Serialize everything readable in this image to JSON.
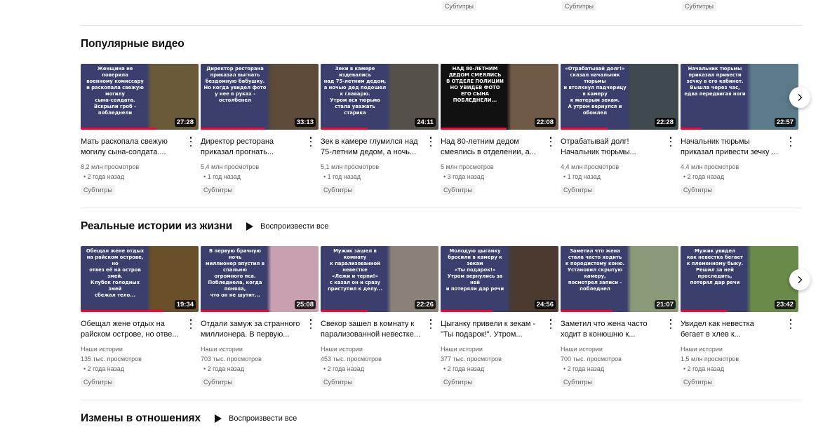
{
  "top_badges": [
    "Субтитры",
    "Субтитры",
    "Субтитры"
  ],
  "sections": [
    {
      "title": "Популярные видео",
      "play_all": "",
      "videos": [
        {
          "title": "Мать раскопала свежую\nмогилу сына-солдата....",
          "views": "8,2 млн просмотров",
          "age": "• 2 года назад",
          "badge": "Субтитры",
          "duration": "27:28",
          "thumb_text": "Женщина не поверила\nвоенному комиссару\nи раскопала свежую могилу\nсына-солдата.\nВскрыли гроб - побледнели",
          "colors": [
            "#3a3f6e",
            "#6b5a3a"
          ]
        },
        {
          "title": "Директор ресторана\nприказал прогнать...",
          "views": "5,4 млн просмотров",
          "age": "• 1 год назад",
          "badge": "Субтитры",
          "duration": "33:13",
          "thumb_text": "Директор ресторана\nприказал выгнать\nбездомную бабушку.\nНо когда увидел фото\nу нее в руках - остолбенел",
          "colors": [
            "#3a3f6e",
            "#5d4a38"
          ]
        },
        {
          "title": "Зек в камере глумился над\n75-летним дедом, а ночь...",
          "views": "5,1 млн просмотров",
          "age": "• 1 год назад",
          "badge": "Субтитры",
          "duration": "24:11",
          "thumb_text": "Зеки в камере издевались\nнад 75-летним дедом,\nа ночью дед подошел к главарю.\nУтром вся тюрьма\nстала уважать старика",
          "colors": [
            "#3a3f6e",
            "#55504a"
          ]
        },
        {
          "title": "Над 80-летним дедом\nсмеялись в отделении, а...",
          "views": "5 млн просмотров",
          "age": "• 3 года назад",
          "badge": "Субтитры",
          "duration": "22:08",
          "thumb_text": "НАД 80-ЛЕТНИМ\nДЕДОМ СМЕЯЛИСЬ\nВ ОТДЕЛЕ ПОЛИЦИИ\nНО УВИДЕВ ФОТО\nЕГО СЫНА\nПОБЛЕДНЕЛИ...",
          "colors": [
            "#111111",
            "#6e5a46"
          ]
        },
        {
          "title": "Отрабатывай долг!\nНачальник тюрьмы...",
          "views": "4,4 млн просмотров",
          "age": "• 1 год назад",
          "badge": "Субтитры",
          "duration": "22:28",
          "thumb_text": "«Отрабатывай долг!»\nсказал начальник тюрьмы\nи втолкнул падчерицу в камеру\nк матерым зекам.\nА утром вернулся и обомлел",
          "colors": [
            "#3a3f6e",
            "#3e4a4e"
          ]
        },
        {
          "title": "Начальник тюрьмы\nприказал привести зечку ...",
          "views": "4,4 млн просмотров",
          "age": "• 2 года назад",
          "badge": "Субтитры",
          "duration": "22:57",
          "thumb_text": "Начальник тюрьмы\nприказал привести\nзечку в его кабинет.\nВышла через час,\nедва передвигая ноги",
          "colors": [
            "#3a3f6e",
            "#5a7a8a"
          ]
        }
      ]
    },
    {
      "title": "Реальные истории из жизни",
      "play_all": "Воспроизвести все",
      "videos": [
        {
          "title": "Обещал жене отдых на\nрайском острове, но отве...",
          "channel": "Наши истории",
          "views": "135 тыс. просмотров",
          "age": "• 2 года назад",
          "badge": "Субтитры",
          "duration": "19:34",
          "thumb_text": "Обещал жене отдых\nна райском острове, но\nотвез её на остров змей.\nКлубок голодных змей\nсбежал тело...",
          "colors": [
            "#3a3f6e",
            "#6a5028"
          ]
        },
        {
          "title": "Отдали замуж за странного\nмиллионера. В первую...",
          "channel": "Наши истории",
          "views": "703 тыс. просмотров",
          "age": "• 2 года назад",
          "badge": "Субтитры",
          "duration": "25:08",
          "thumb_text": "В первую брачную ночь\nмиллионер впустил в спальню\nогромного пса.\nПобледнела, когда поняла,\nчто он не шутит...",
          "colors": [
            "#3a3f6e",
            "#c8a0b0"
          ]
        },
        {
          "title": "Свекор зашел в комнату к\nпарализованной невестке...",
          "channel": "Наши истории",
          "views": "453 тыс. просмотров",
          "age": "• 2 года назад",
          "badge": "Субтитры",
          "duration": "22:26",
          "thumb_text": "Мужик зашел в комнату\nк парализованной невестке\n«Лежи и терпи!»\nс казал он и сразу\nприступил к делу...",
          "colors": [
            "#3a3f6e",
            "#8a8278"
          ]
        },
        {
          "title": "Цыганку привели к зекам -\n\"Ты подарок!\". Утром...",
          "channel": "Наши истории",
          "views": "377 тыс. просмотров",
          "age": "• 2 года назад",
          "badge": "Субтитры",
          "duration": "24:56",
          "thumb_text": "Молодую цыганку\nбросили в камеру к зекам\n«Ты подарок!»\nУтром вернулись за ней\nи потеряли дар речи",
          "colors": [
            "#3a3f6e",
            "#4a3a30"
          ]
        },
        {
          "title": "Заметил что жена часто\nходит в конюшню к...",
          "channel": "Наши истории",
          "views": "700 тыс. просмотров",
          "age": "• 2 года назад",
          "badge": "Субтитры",
          "duration": "21:07",
          "thumb_text": "Заметил что жена\nстала часто ходить\nк породистому коню.\nУстановил скрытую камеру,\nпосмотрел записи - побледнел",
          "colors": [
            "#3a3f6e",
            "#8a9a78"
          ]
        },
        {
          "title": "Увидел как невестка\nбегает в хлев к...",
          "channel": "Наши истории",
          "views": "1,5 млн просмотров",
          "age": "• 2 года назад",
          "badge": "Субтитры",
          "duration": "23:42",
          "thumb_text": "Мужик увидел\nкак невестка бегает\nк племенному быку.\nРешил за ней проследить,\nпотерял дар речи",
          "colors": [
            "#3a3f6e",
            "#6a8a4a"
          ]
        }
      ]
    },
    {
      "title": "Измены в отношениях",
      "play_all": "Воспроизвести все",
      "videos": []
    }
  ],
  "icons": {
    "next": "chevron-right-icon",
    "more": "more-vert-icon",
    "play": "play-icon"
  },
  "colors": {
    "progress": "#ff0033",
    "text": "#0f0f0f",
    "secondary": "#606060"
  }
}
